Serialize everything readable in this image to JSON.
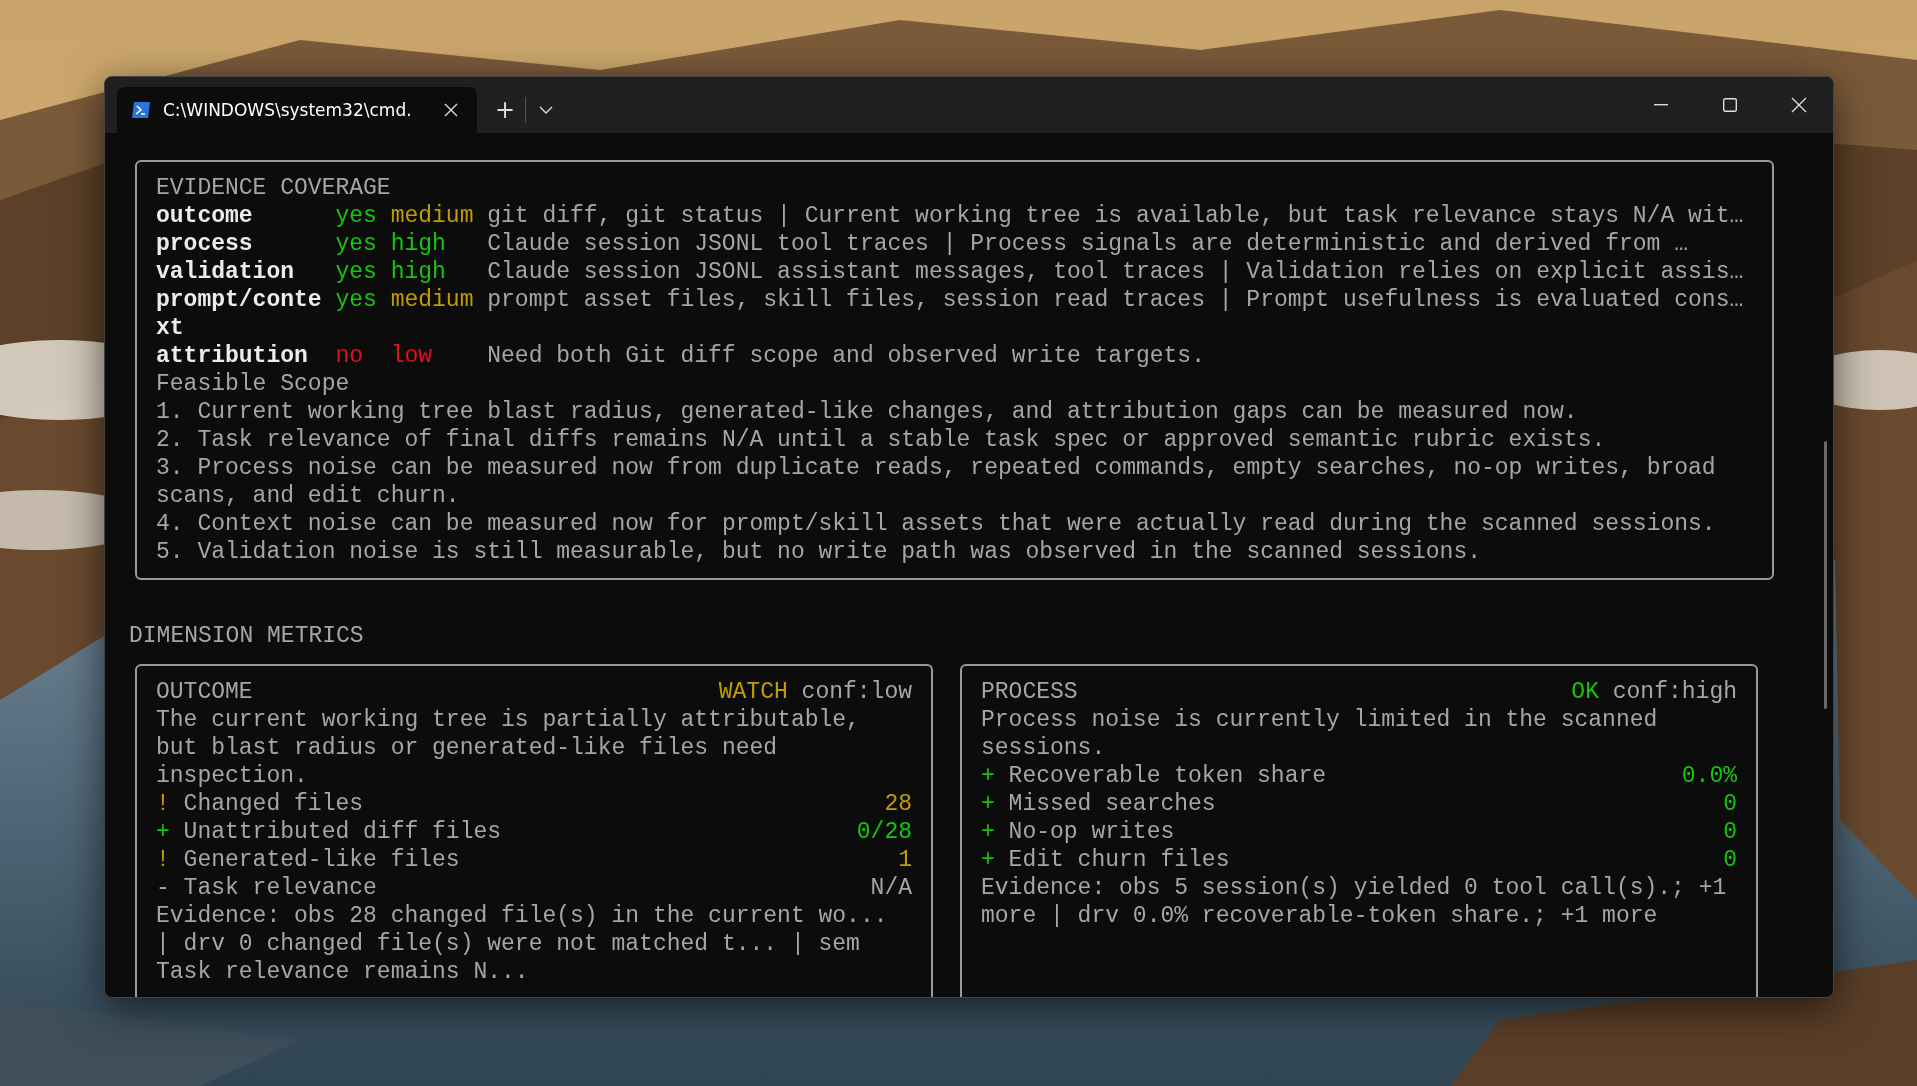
{
  "window": {
    "tab_title": "C:\\WINDOWS\\system32\\cmd.",
    "new_tab": "+"
  },
  "coverage": {
    "title": "EVIDENCE COVERAGE",
    "rows": [
      {
        "name": "outcome",
        "available": {
          "text": "yes",
          "color": "#16c60c"
        },
        "confidence": {
          "text": "medium",
          "color": "#c19c00"
        },
        "detail": "git diff, git status | Current working tree is available, but task relevance stays N/A wit…"
      },
      {
        "name": "process",
        "available": {
          "text": "yes",
          "color": "#16c60c"
        },
        "confidence": {
          "text": "high",
          "color": "#16c60c"
        },
        "detail": "Claude session JSONL tool traces | Process signals are deterministic and derived from …"
      },
      {
        "name": "validation",
        "available": {
          "text": "yes",
          "color": "#16c60c"
        },
        "confidence": {
          "text": "high",
          "color": "#16c60c"
        },
        "detail": "Claude session JSONL assistant messages, tool traces | Validation relies on explicit assis…"
      },
      {
        "name": "prompt/context",
        "available": {
          "text": "yes",
          "color": "#16c60c"
        },
        "confidence": {
          "text": "medium",
          "color": "#c19c00"
        },
        "detail": "prompt asset files, skill files, session read traces | Prompt usefulness is evaluated cons…"
      },
      {
        "name": "attribution",
        "available": {
          "text": "no",
          "color": "#e0101f"
        },
        "confidence": {
          "text": "low",
          "color": "#e0101f"
        },
        "detail": "Need both Git diff scope and observed write targets."
      }
    ],
    "scope_title": "Feasible Scope",
    "scope_items": [
      "1. Current working tree blast radius, generated-like changes, and attribution gaps can be measured now.",
      "2. Task relevance of final diffs remains N/A until a stable task spec or approved semantic rubric exists.",
      "3. Process noise can be measured now from duplicate reads, repeated commands, empty searches, no-op writes, broad scans, and edit churn.",
      "4. Context noise can be measured now for prompt/skill assets that were actually read during the scanned sessions.",
      "5. Validation noise is still measurable, but no write path was observed in the scanned sessions."
    ]
  },
  "metrics": {
    "title": "DIMENSION METRICS",
    "cards": [
      {
        "title": "OUTCOME",
        "status": {
          "text": "WATCH",
          "color": "#c19c00"
        },
        "confidence": "conf:low",
        "summary": "The current working tree is partially attributable, but blast radius or generated-like files need inspection.",
        "rows": [
          {
            "sign": "!",
            "color": "#c19c00",
            "label": "Changed files",
            "value": "28"
          },
          {
            "sign": "+",
            "color": "#16c60c",
            "label": "Unattributed diff files",
            "value": "0/28"
          },
          {
            "sign": "!",
            "color": "#c19c00",
            "label": "Generated-like files",
            "value": "1"
          },
          {
            "sign": "-",
            "color": "#a6a6a6",
            "label": "Task relevance",
            "value": "N/A"
          }
        ],
        "evidence": "Evidence: obs 28 changed file(s) in the current wo... | drv 0 changed file(s) were not matched t... | sem Task relevance remains N..."
      },
      {
        "title": "PROCESS",
        "status": {
          "text": "OK",
          "color": "#16c60c"
        },
        "confidence": "conf:high",
        "summary": "Process noise is currently limited in the scanned sessions.",
        "rows": [
          {
            "sign": "+",
            "color": "#16c60c",
            "label": "Recoverable token share",
            "value": "0.0%"
          },
          {
            "sign": "+",
            "color": "#16c60c",
            "label": "Missed searches",
            "value": "0"
          },
          {
            "sign": "+",
            "color": "#16c60c",
            "label": "No-op writes",
            "value": "0"
          },
          {
            "sign": "+",
            "color": "#16c60c",
            "label": "Edit churn files",
            "value": "0"
          }
        ],
        "evidence": "Evidence: obs 5 session(s) yielded 0 tool call(s).; +1 more | drv 0.0% recoverable-token share.; +1 more"
      }
    ]
  }
}
